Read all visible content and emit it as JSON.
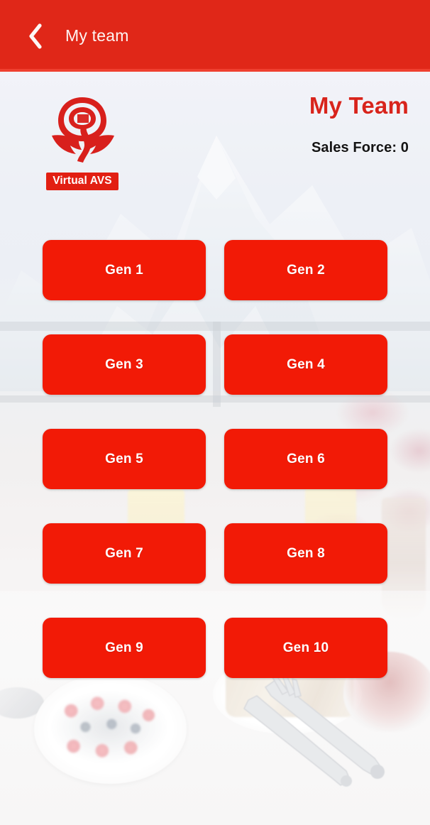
{
  "appbar": {
    "back_icon": "chevron-left-icon",
    "title": "My team",
    "bg_color": "#e02718"
  },
  "brand": {
    "logo_icon": "rose-logo-icon",
    "banner_label": "Virtual AVS",
    "banner_color": "#e21f12"
  },
  "headings": {
    "page_title": "My Team",
    "page_title_color": "#d8241c",
    "sales_force": "Sales Force: 0"
  },
  "generations": {
    "button_color": "#f21a06",
    "items": [
      {
        "label": "Gen 1"
      },
      {
        "label": "Gen 2"
      },
      {
        "label": "Gen 3"
      },
      {
        "label": "Gen 4"
      },
      {
        "label": "Gen 5"
      },
      {
        "label": "Gen 6"
      },
      {
        "label": "Gen 7"
      },
      {
        "label": "Gen 8"
      },
      {
        "label": "Gen 9"
      },
      {
        "label": "Gen 10"
      }
    ]
  },
  "background": {
    "description": "faded photograph of snow-capped mountain behind a balcony breakfast table"
  }
}
